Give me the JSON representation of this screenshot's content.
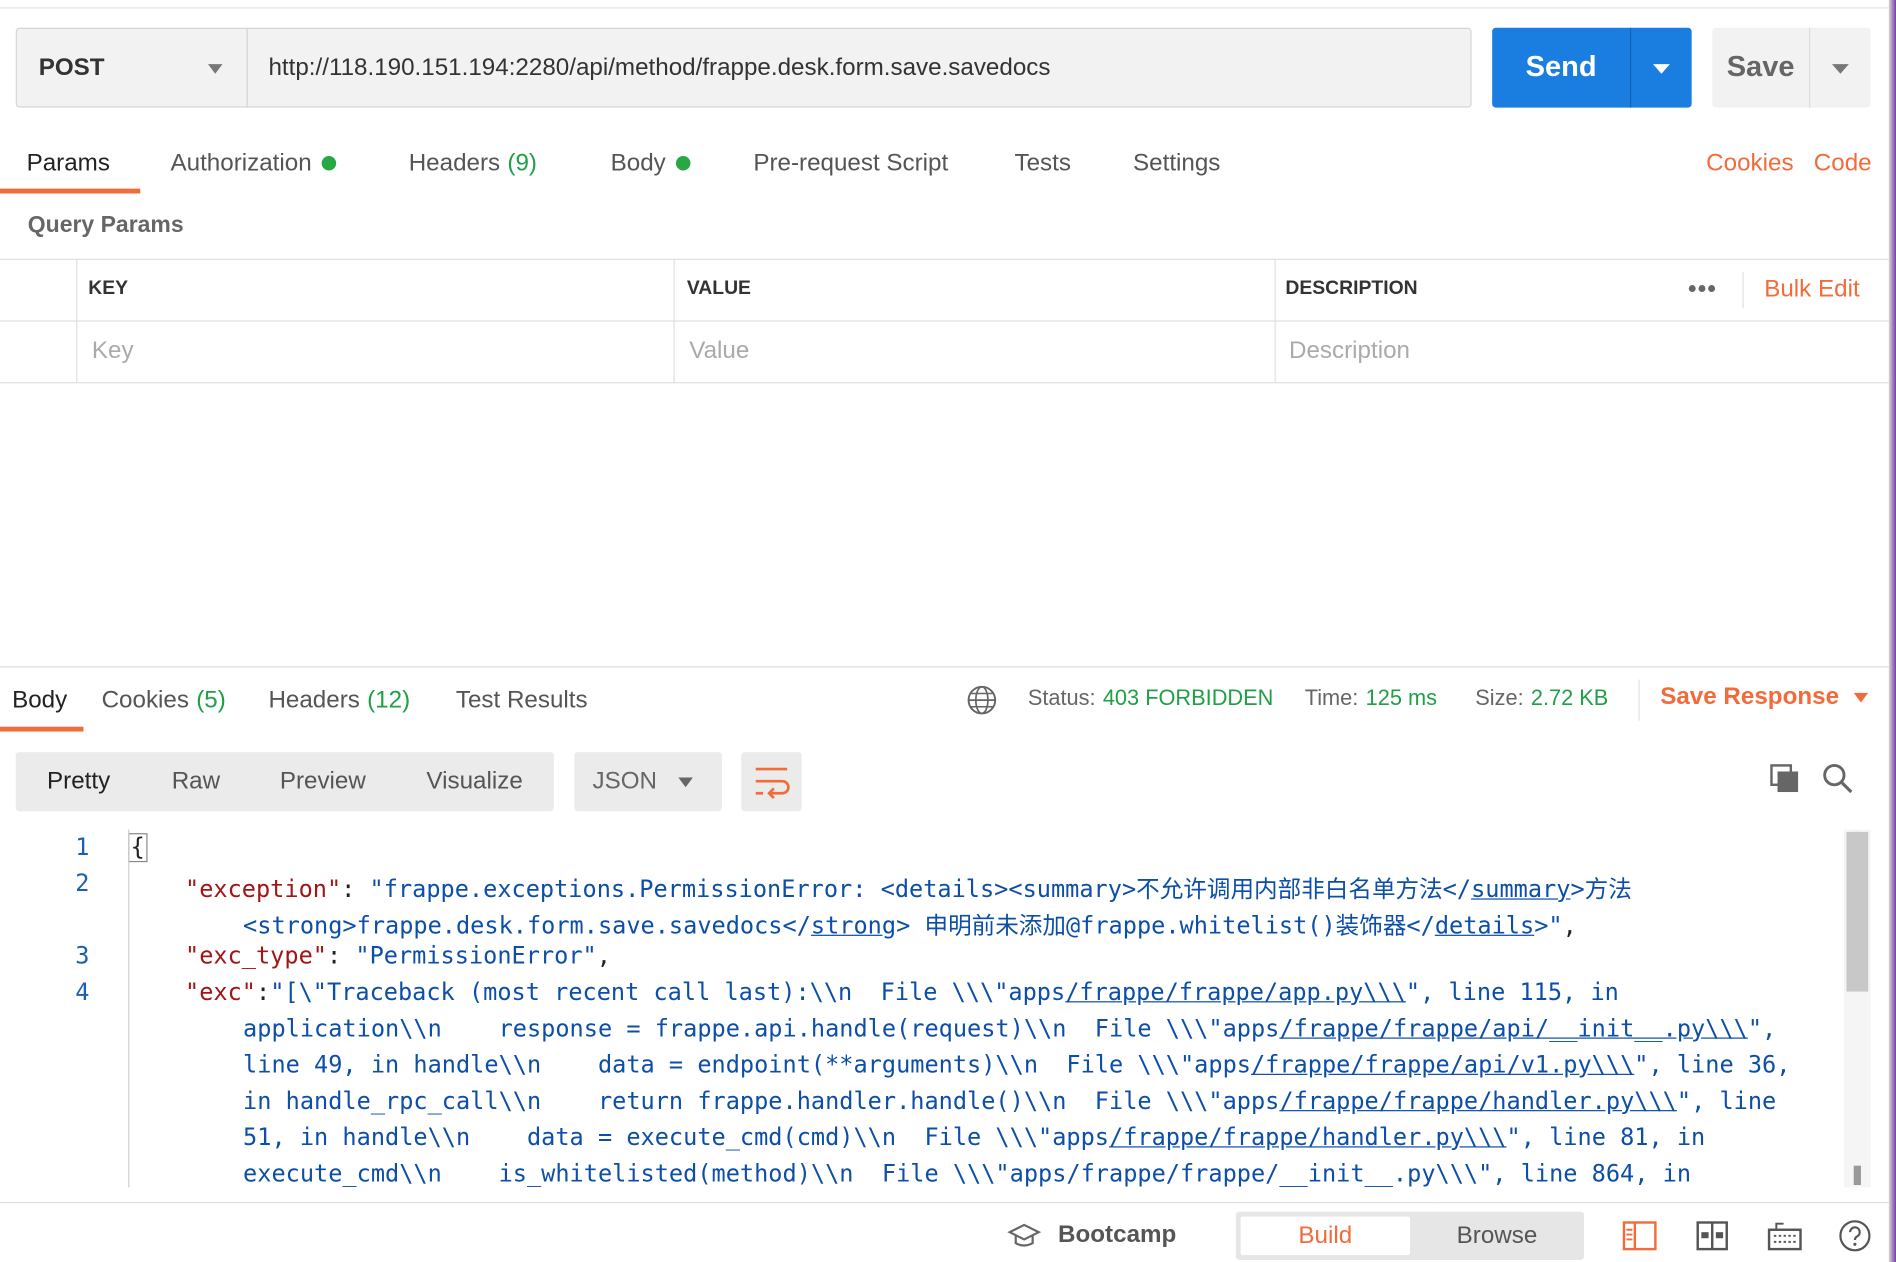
{
  "request": {
    "method": "POST",
    "url": "http://118.190.151.194:2280/api/method/frappe.desk.form.save.savedocs",
    "send_label": "Send",
    "save_label": "Save"
  },
  "request_tabs": [
    {
      "label": "Params",
      "active": true
    },
    {
      "label": "Authorization",
      "dot": true
    },
    {
      "label": "Headers",
      "count": "(9)"
    },
    {
      "label": "Body",
      "dot": true
    },
    {
      "label": "Pre-request Script"
    },
    {
      "label": "Tests"
    },
    {
      "label": "Settings"
    }
  ],
  "request_links": {
    "cookies": "Cookies",
    "code": "Code"
  },
  "params": {
    "title": "Query Params",
    "columns": [
      "KEY",
      "VALUE",
      "DESCRIPTION"
    ],
    "placeholders": [
      "Key",
      "Value",
      "Description"
    ],
    "bulk_edit": "Bulk Edit"
  },
  "response_tabs": [
    {
      "label": "Body",
      "active": true
    },
    {
      "label": "Cookies",
      "count": "(5)"
    },
    {
      "label": "Headers",
      "count": "(12)"
    },
    {
      "label": "Test Results"
    }
  ],
  "response_status": {
    "status_label": "Status:",
    "status_value": "403 FORBIDDEN",
    "time_label": "Time:",
    "time_value": "125 ms",
    "size_label": "Size:",
    "size_value": "2.72 KB",
    "save_response": "Save Response"
  },
  "view_modes": [
    "Pretty",
    "Raw",
    "Preview",
    "Visualize"
  ],
  "format": "JSON",
  "code_lines": [
    {
      "num": "1",
      "text": "{"
    },
    {
      "num": "2",
      "text": "\"exception\": \"frappe.exceptions.PermissionError: <details><summary>不允许调用内部非白名单方法</summary>方法"
    },
    {
      "num": "",
      "text": "<strong>frappe.desk.form.save.savedocs</strong> 申明前未添加@frappe.whitelist()装饰器</details>\","
    },
    {
      "num": "3",
      "text": "\"exc_type\": \"PermissionError\","
    },
    {
      "num": "4",
      "text": "\"exc\":\"[\\\"Traceback (most recent call last):\\\\n  File \\\\\\\"apps/frappe/frappe/app.py\\\\\\\", line 115, in"
    },
    {
      "num": "",
      "text": "application\\\\n    response = frappe.api.handle(request)\\\\n  File \\\\\\\"apps/frappe/frappe/api/__init__.py\\\\\\\","
    },
    {
      "num": "",
      "text": "line 49, in handle\\\\n    data = endpoint(**arguments)\\\\n  File \\\\\\\"apps/frappe/frappe/api/v1.py\\\\\\\", line 36,"
    },
    {
      "num": "",
      "text": "in handle_rpc_call\\\\n    return frappe.handler.handle()\\\\n  File \\\\\\\"apps/frappe/frappe/handler.py\\\\\\\", line"
    },
    {
      "num": "",
      "text": "51, in handle\\\\n    data = execute_cmd(cmd)\\\\n  File \\\\\\\"apps/frappe/frappe/handler.py\\\\\\\", line 81, in"
    },
    {
      "num": "",
      "text": "execute_cmd\\\\n    is_whitelisted(method)\\\\n  File \\\\\\\"apps/frappe/frappe/__init__.py\\\\\\\", line 864, in"
    }
  ],
  "footer": {
    "bootcamp": "Bootcamp",
    "build": "Build",
    "browse": "Browse"
  },
  "colors": {
    "accent": "#f26b3a",
    "send": "#1a7ee1",
    "success": "#20a046",
    "json_key": "#a31515",
    "json_string": "#0d4fa8"
  }
}
